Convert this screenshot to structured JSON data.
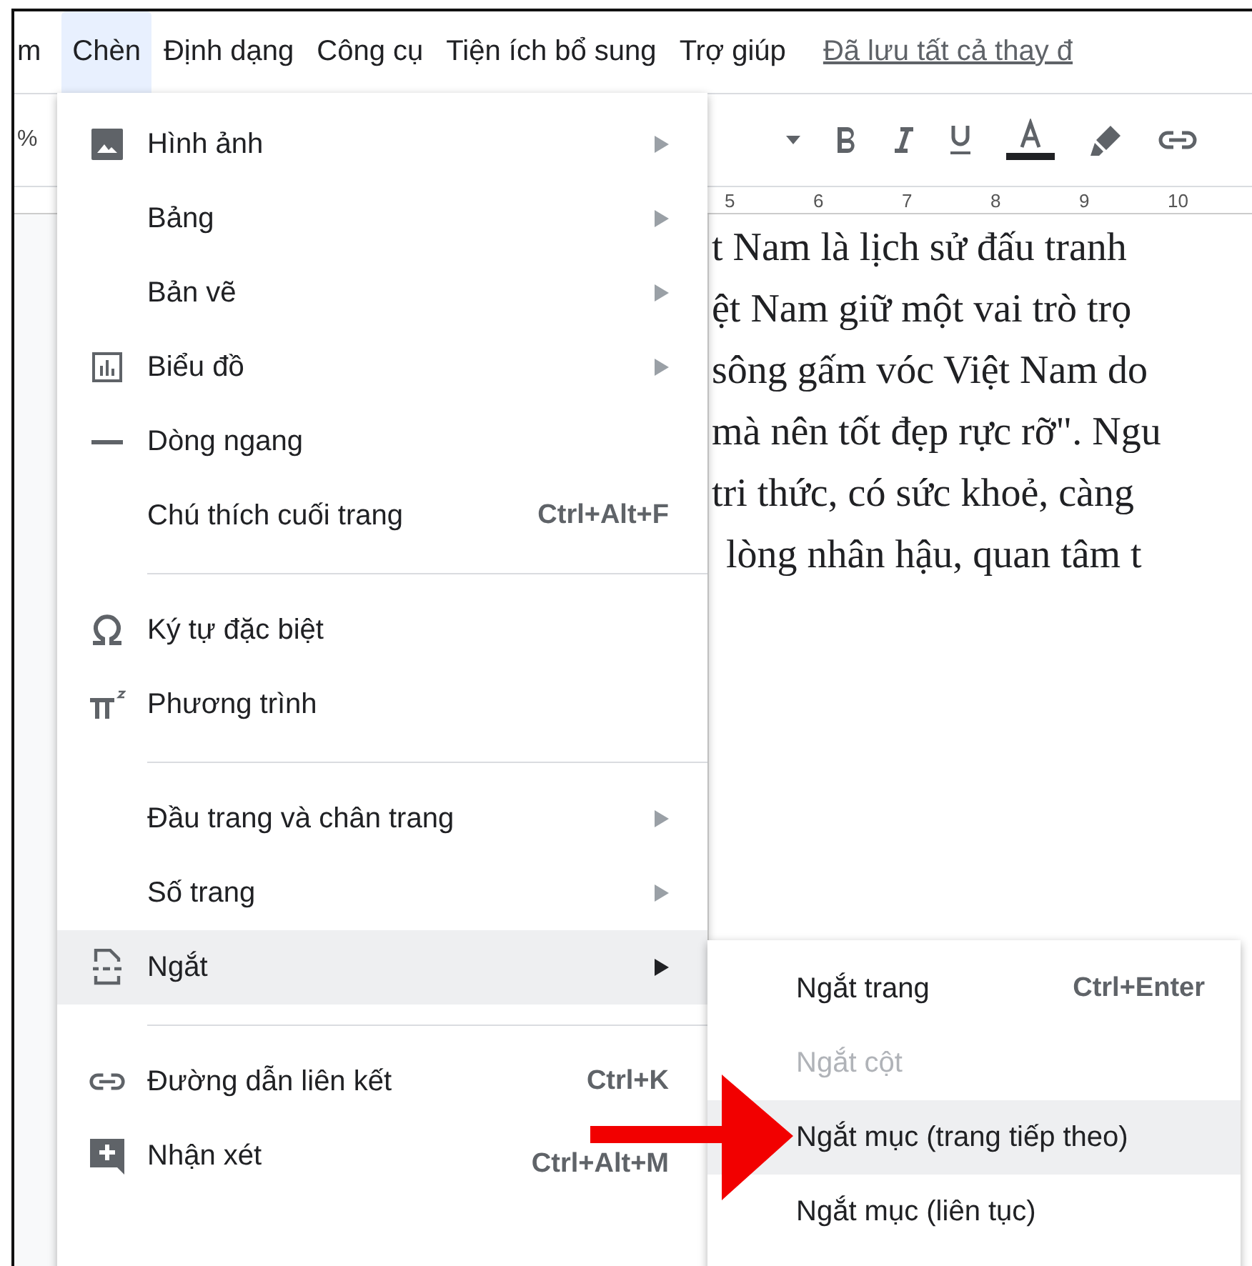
{
  "menubar": {
    "items": [
      {
        "label": "m",
        "selected": false
      },
      {
        "label": "Chèn",
        "selected": true
      },
      {
        "label": "Định dạng",
        "selected": false
      },
      {
        "label": "Công cụ",
        "selected": false
      },
      {
        "label": "Tiện ích bổ sung",
        "selected": false
      },
      {
        "label": "Trợ giúp",
        "selected": false
      }
    ],
    "saved_status": "Đã lưu tất cả thay đ"
  },
  "toolbar": {
    "zoom": "%"
  },
  "ruler": {
    "numbers": [
      "5",
      "6",
      "7",
      "8",
      "9",
      "10"
    ]
  },
  "document": {
    "lines": [
      "t Nam là lịch sử đấu tranh",
      "ệt Nam giữ một vai trò trọ",
      "sông gấm vóc Việt Nam do",
      "mà nên tốt đẹp rực rỡ\". Ngu",
      "tri thức, có sức khoẻ, càng",
      "lòng nhân hậu, quan tâm t"
    ]
  },
  "menu": {
    "sections": [
      [
        {
          "label": "Hình ảnh",
          "submenu": true,
          "selected": false
        },
        {
          "label": "Bảng",
          "submenu": true,
          "selected": false
        },
        {
          "label": "Bản vẽ",
          "submenu": true,
          "selected": false
        },
        {
          "label": "Biểu đồ",
          "submenu": true,
          "selected": false
        },
        {
          "label": "Dòng ngang",
          "submenu": false,
          "selected": false
        },
        {
          "label": "Chú thích cuối trang",
          "shortcut": "Ctrl+Alt+F",
          "submenu": false,
          "selected": false
        }
      ],
      [
        {
          "label": "Ký tự đặc biệt",
          "submenu": false,
          "selected": false
        },
        {
          "label": "Phương trình",
          "submenu": false,
          "selected": false
        }
      ],
      [
        {
          "label": "Đầu trang và chân trang",
          "submenu": true,
          "selected": false
        },
        {
          "label": "Số trang",
          "submenu": true,
          "selected": false
        },
        {
          "label": "Ngắt",
          "submenu": true,
          "selected": true
        }
      ],
      [
        {
          "label": "Đường dẫn liên kết",
          "shortcut": "Ctrl+K",
          "submenu": false,
          "selected": false
        },
        {
          "label": "Nhận xét",
          "shortcut": "Ctrl+Alt+M",
          "submenu": false,
          "selected": false
        }
      ]
    ]
  },
  "submenu": {
    "items": [
      {
        "label": "Ngắt trang",
        "shortcut": "Ctrl+Enter",
        "disabled": false,
        "selected": false
      },
      {
        "label": "Ngắt cột",
        "disabled": true,
        "selected": false
      },
      {
        "label": "Ngắt mục (trang tiếp theo)",
        "disabled": false,
        "selected": true
      },
      {
        "label": "Ngắt mục (liên tục)",
        "disabled": false,
        "selected": false
      }
    ]
  }
}
